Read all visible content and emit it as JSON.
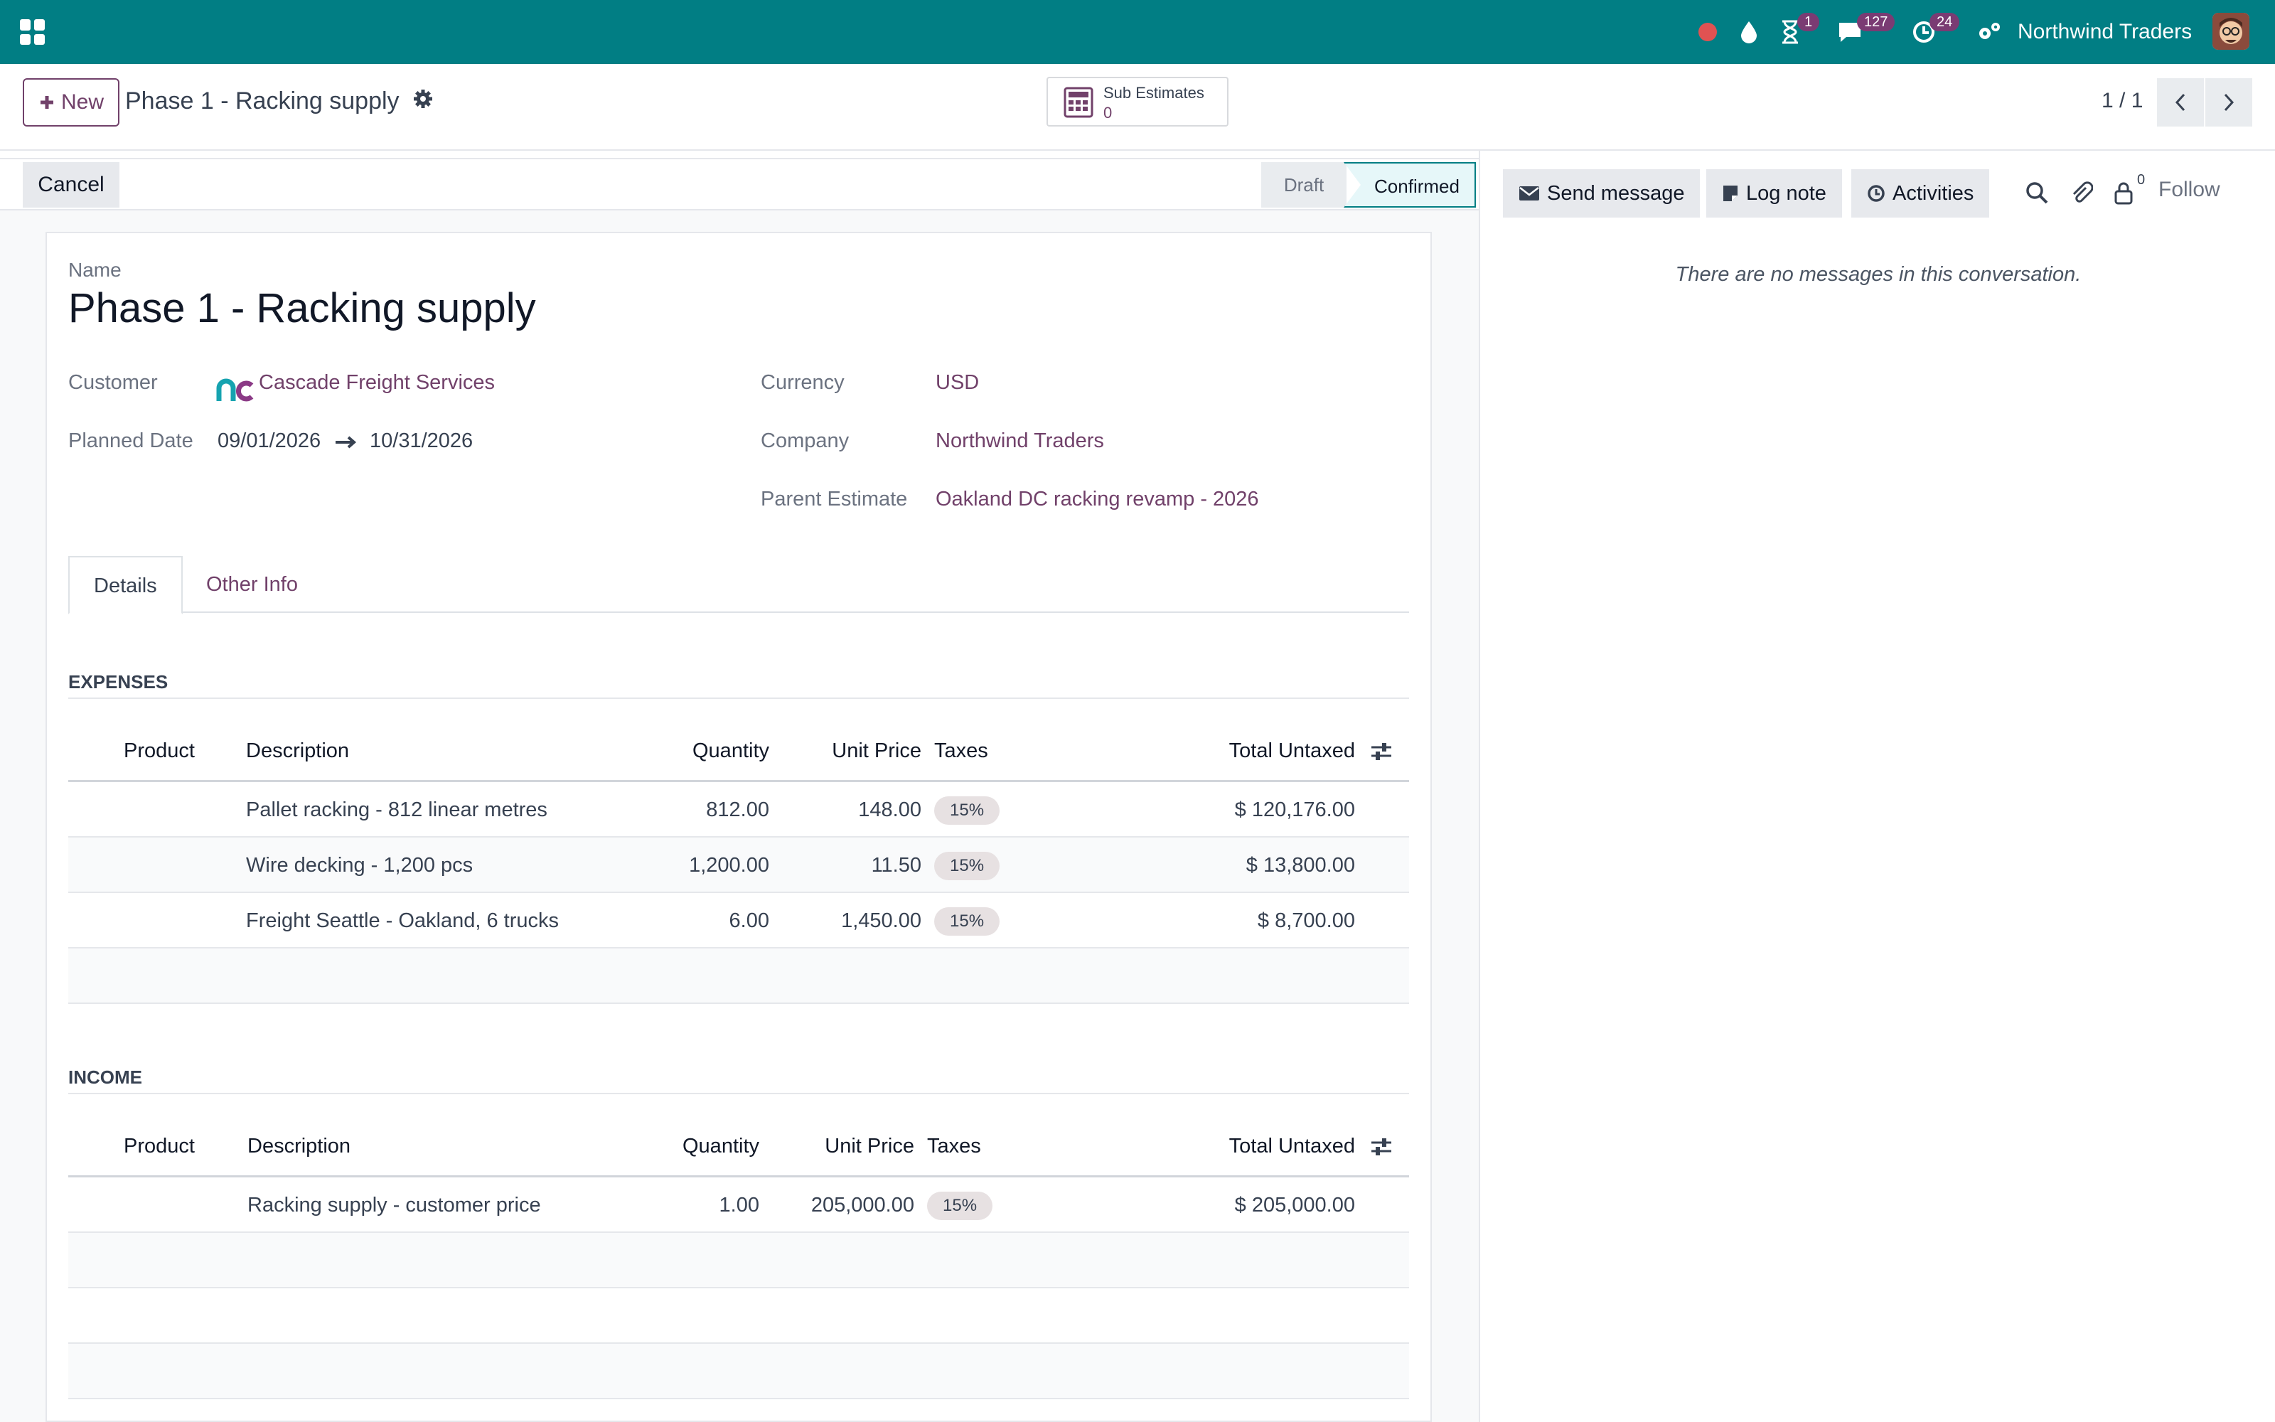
{
  "topbar": {
    "company": "Northwind Traders",
    "activity_count": "1",
    "messages_count": "127",
    "clock_count": "24",
    "color": "#017e84"
  },
  "control": {
    "new_label": "New",
    "title": "Phase 1 - Racking supply",
    "smart_button": {
      "label": "Sub Estimates",
      "value": "0"
    },
    "pager": "1 / 1"
  },
  "status": {
    "cancel_label": "Cancel",
    "stages": [
      "Draft",
      "Confirmed"
    ],
    "current": "Confirmed"
  },
  "form": {
    "name_label": "Name",
    "name": "Phase 1 - Racking supply",
    "customer_label": "Customer",
    "customer": "Cascade Freight Services",
    "planned_label": "Planned Date",
    "date_start": "09/01/2026",
    "date_end": "10/31/2026",
    "currency_label": "Currency",
    "currency": "USD",
    "company_label": "Company",
    "company": "Northwind Traders",
    "parent_label": "Parent Estimate",
    "parent": "Oakland DC racking revamp - 2026"
  },
  "tabs": [
    "Details",
    "Other Info"
  ],
  "expenses": {
    "title": "EXPENSES",
    "headers": [
      "Product",
      "Description",
      "Quantity",
      "Unit Price",
      "Taxes",
      "Total Untaxed"
    ],
    "rows": [
      {
        "description": "Pallet racking - 812 linear metres",
        "quantity": "812.00",
        "unit_price": "148.00",
        "tax": "15%",
        "total": "$ 120,176.00"
      },
      {
        "description": "Wire decking - 1,200 pcs",
        "quantity": "1,200.00",
        "unit_price": "11.50",
        "tax": "15%",
        "total": "$ 13,800.00"
      },
      {
        "description": "Freight Seattle - Oakland, 6 trucks",
        "quantity": "6.00",
        "unit_price": "1,450.00",
        "tax": "15%",
        "total": "$ 8,700.00"
      }
    ]
  },
  "income": {
    "title": "INCOME",
    "headers": [
      "Product",
      "Description",
      "Quantity",
      "Unit Price",
      "Taxes",
      "Total Untaxed"
    ],
    "rows": [
      {
        "description": "Racking supply - customer price",
        "quantity": "1.00",
        "unit_price": "205,000.00",
        "tax": "15%",
        "total": "$ 205,000.00"
      }
    ]
  },
  "chatter": {
    "send_message": "Send message",
    "log_note": "Log note",
    "activities": "Activities",
    "followers_count": "0",
    "follow": "Follow",
    "empty": "There are no messages in this conversation."
  }
}
